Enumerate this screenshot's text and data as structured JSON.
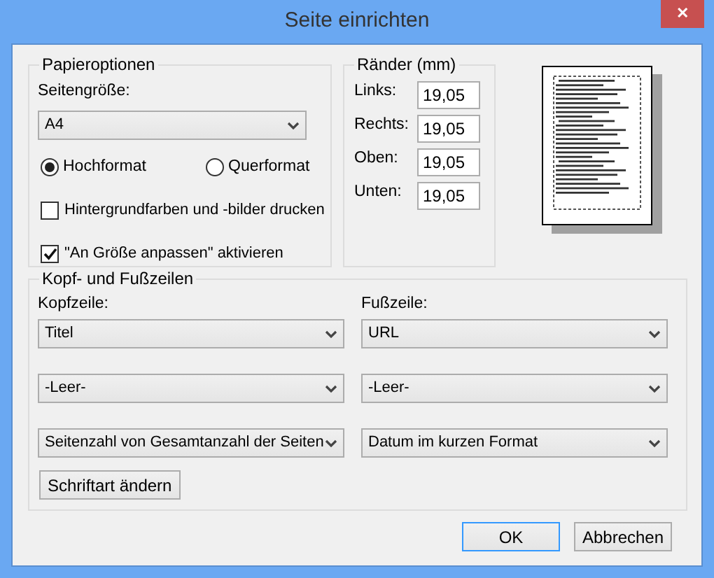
{
  "window": {
    "title": "Seite einrichten",
    "close": "✕"
  },
  "paper_options": {
    "legend": "Papieroptionen",
    "size_label": "Seitengröße:",
    "size_value": "A4",
    "orientation": [
      {
        "label": "Hochformat",
        "selected": true
      },
      {
        "label": "Querformat",
        "selected": false
      }
    ],
    "checkboxes": [
      {
        "label": "Hintergrundfarben und -bilder drucken",
        "checked": false
      },
      {
        "label": "\"An Größe anpassen\" aktivieren",
        "checked": true
      }
    ]
  },
  "margins": {
    "legend": "Ränder (mm)",
    "fields": [
      {
        "label": "Links:",
        "value": "19,05"
      },
      {
        "label": "Rechts:",
        "value": "19,05"
      },
      {
        "label": "Oben:",
        "value": "19,05"
      },
      {
        "label": "Unten:",
        "value": "19,05"
      }
    ]
  },
  "headers_footers": {
    "legend": "Kopf- und Fußzeilen",
    "header_label": "Kopfzeile:",
    "footer_label": "Fußzeile:",
    "header": [
      "Titel",
      "-Leer-",
      "Seitenzahl von Gesamtanzahl der Seiten"
    ],
    "footer": [
      "URL",
      "-Leer-",
      "Datum im kurzen Format"
    ],
    "font_button": "Schriftart ändern"
  },
  "buttons": [
    "OK",
    "Abbrechen"
  ]
}
